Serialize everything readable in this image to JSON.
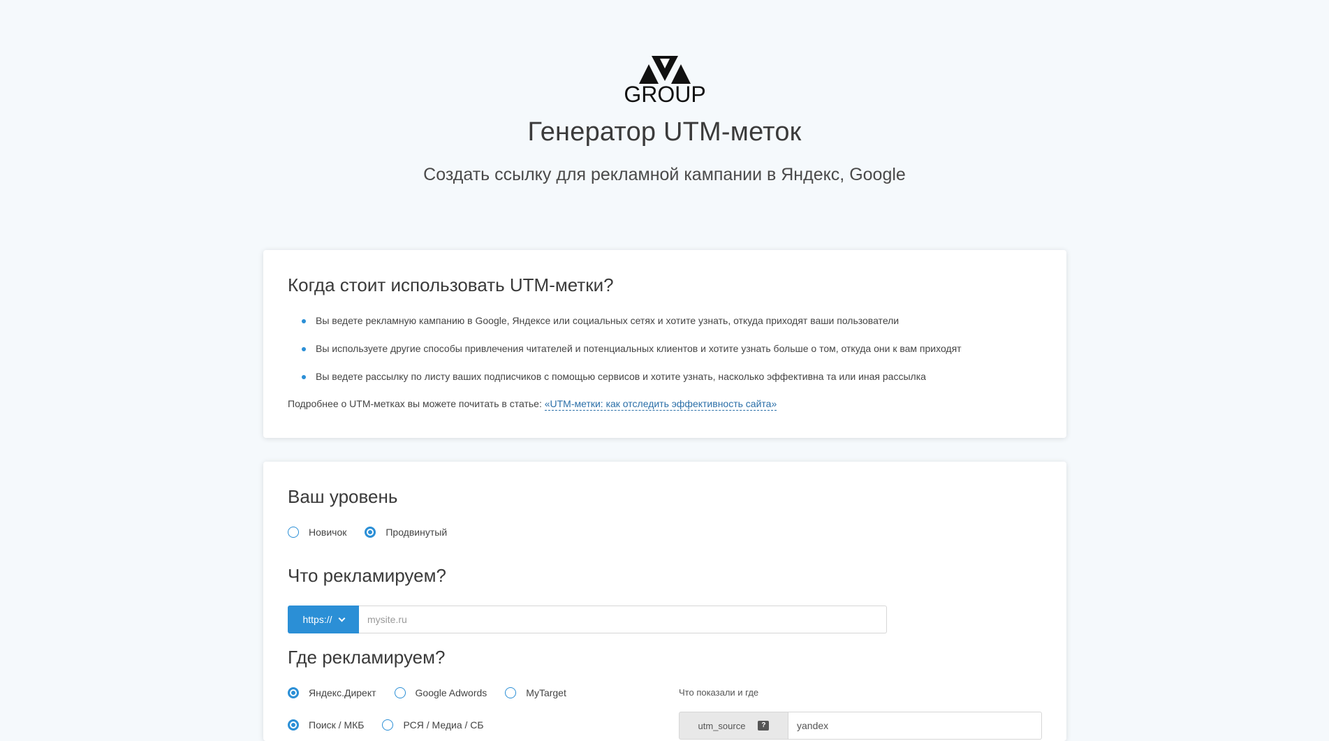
{
  "header": {
    "logo_text": "GROUP",
    "title": "Генератор UTM-меток",
    "subtitle": "Создать ссылку для рекламной кампании в Яндекс, Google"
  },
  "info": {
    "heading": "Когда стоит использовать UTM-метки?",
    "bullets": [
      "Вы ведете рекламную кампанию в Google, Яндексе или социальных сетях и хотите узнать, откуда приходят ваши пользователи",
      "Вы используете другие способы привлечения читателей и потенциальных клиентов и хотите узнать больше о том, откуда они к вам приходят",
      "Вы ведете рассылку по листу ваших подписчиков с помощью сервисов и хотите узнать, насколько эффективна та или иная рассылка"
    ],
    "more_prefix": "Подробнее о UTM-метках вы можете почитать в статье: ",
    "more_link": "«UTM-метки: как отследить эффективность сайта»"
  },
  "form": {
    "level": {
      "heading": "Ваш уровень",
      "options": [
        "Новичок",
        "Продвинутый"
      ],
      "selected": "Продвинутый"
    },
    "what": {
      "heading": "Что рекламируем?",
      "protocol": "https://",
      "url_placeholder": "mysite.ru"
    },
    "where": {
      "heading": "Где рекламируем?",
      "platforms": [
        "Яндекс.Директ",
        "Google Adwords",
        "MyTarget"
      ],
      "platform_selected": "Яндекс.Директ",
      "placements": [
        "Поиск / МКБ",
        "РСЯ / Медиа / СБ"
      ],
      "placement_selected": "Поиск / МКБ",
      "shown_label": "Что показали и где",
      "utm_param": "utm_source",
      "help_badge": "?",
      "utm_value": "yandex"
    }
  },
  "colors": {
    "accent": "#2b8fd6",
    "background": "#f5f9fc"
  }
}
